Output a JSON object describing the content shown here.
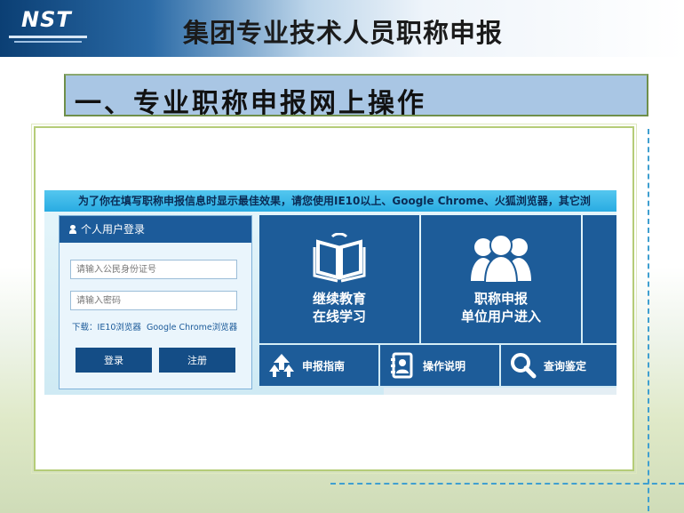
{
  "header": {
    "logo_text": "NST",
    "title": "集团专业技术人员职称申报"
  },
  "section": {
    "heading": "一、专业职称申报网上操作"
  },
  "screenshot": {
    "notice": "为了你在填写职称申报信息时显示最佳效果，请您使用IE10以上、Google Chrome、火狐浏览器，其它浏",
    "login": {
      "title": "个人用户登录",
      "id_placeholder": "请输入公民身份证号",
      "password_placeholder": "请输入密码",
      "download_prefix": "下载：",
      "download_ie": "IE10浏览器",
      "download_chrome": "Google Chrome浏览器",
      "login_button": "登录",
      "register_button": "注册"
    },
    "tiles": {
      "education_line1": "继续教育",
      "education_line2": "在线学习",
      "title_line1": "职称申报",
      "title_line2": "单位用户进入"
    },
    "small_tiles": {
      "guide": "申报指南",
      "manual": "操作说明",
      "query": "查询鉴定"
    }
  },
  "colors": {
    "tile_blue": "#1d5c99",
    "notice_blue": "#29abe2",
    "section_bg": "#a9c6e4"
  }
}
